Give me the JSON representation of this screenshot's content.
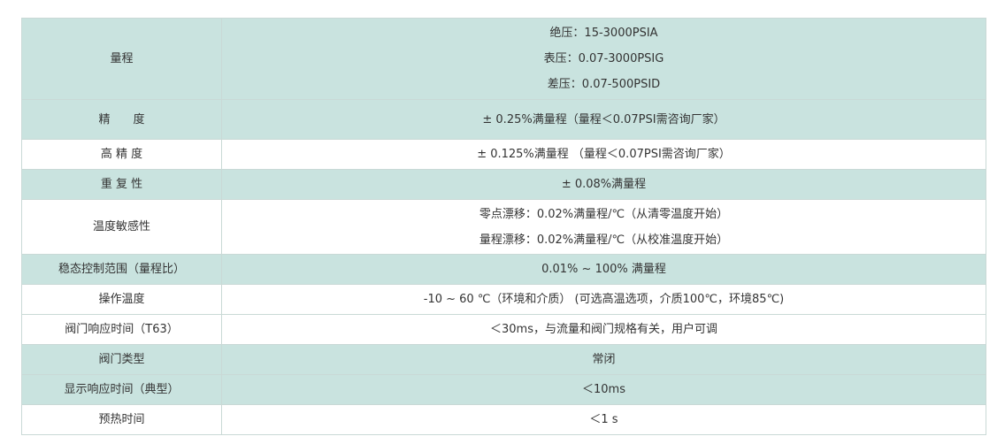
{
  "colors": {
    "shaded_row": "#c9e3df",
    "plain_row": "#ffffff",
    "border": "#c9d9d6",
    "text": "#333333"
  },
  "rows": [
    {
      "label": "量程",
      "values": [
        "绝压：15-3000PSIA",
        "表压：0.07-3000PSIG",
        "差压：0.07-500PSID"
      ]
    },
    {
      "label": "精　　度",
      "values": [
        "± 0.25%满量程（量程＜0.07PSI需咨询厂家）"
      ]
    },
    {
      "label": "高 精 度",
      "values": [
        "± 0.125%满量程 （量程＜0.07PSI需咨询厂家）"
      ]
    },
    {
      "label": "重 复 性",
      "values": [
        "± 0.08%满量程"
      ]
    },
    {
      "label": "温度敏感性",
      "values": [
        "零点漂移：0.02%满量程/℃（从清零温度开始）",
        "量程漂移：0.02%满量程/℃（从校准温度开始）"
      ]
    },
    {
      "label": "稳态控制范围（量程比）",
      "values": [
        "0.01% ~ 100% 满量程"
      ]
    },
    {
      "label": "操作温度",
      "values": [
        "-10 ~ 60 ℃（环境和介质） (可选高温选项，介质100℃，环境85℃)"
      ]
    },
    {
      "label": "阀门响应时间（T63）",
      "values": [
        "＜30ms，与流量和阀门规格有关，用户可调"
      ]
    },
    {
      "label": "阀门类型",
      "values": [
        "常闭"
      ]
    },
    {
      "label": "显示响应时间（典型）",
      "values": [
        "＜10ms"
      ]
    },
    {
      "label": "预热时间",
      "values": [
        "＜1 s"
      ]
    }
  ]
}
